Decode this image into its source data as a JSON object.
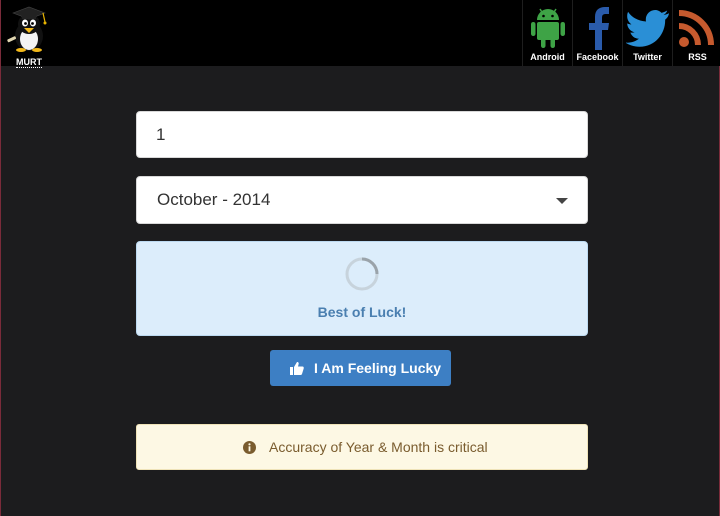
{
  "header": {
    "logo_label": "MURT",
    "social": [
      {
        "label": "Android",
        "icon": "android-icon",
        "color": "#3ea346"
      },
      {
        "label": "Facebook",
        "icon": "facebook-icon",
        "color": "#2a5bab"
      },
      {
        "label": "Twitter",
        "icon": "twitter-icon",
        "color": "#2a8fd6"
      },
      {
        "label": "RSS",
        "icon": "rss-icon",
        "color": "#c65a2e"
      }
    ]
  },
  "form": {
    "number_value": "1",
    "month_selected": "October - 2014"
  },
  "status": {
    "message": "Best of Luck!"
  },
  "actions": {
    "lucky_label": "I Am Feeling Lucky"
  },
  "notice": {
    "text": "Accuracy of Year & Month is critical"
  },
  "colors": {
    "background": "#1c1c1e",
    "topbar": "#000000",
    "button": "#3d7fc4",
    "panel": "#dcedfb",
    "notice_bg": "#fdf8e4"
  }
}
